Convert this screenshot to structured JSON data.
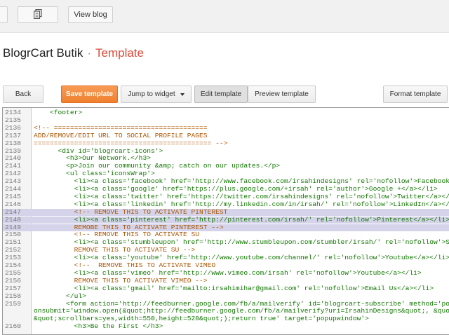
{
  "toolbar": {
    "view_blog": "View blog"
  },
  "header": {
    "blog_name": "BlogrCart Butik",
    "separator": "·",
    "page_title": "Template"
  },
  "actions": {
    "back": "Back",
    "save_template": "Save template",
    "jump_to_widget": "Jump to widget",
    "edit_template": "Edit template",
    "preview_template": "Preview template",
    "format_template": "Format template"
  },
  "colors": {
    "accent_orange": "#f0802f",
    "page_title": "#dd4b39",
    "highlight": "#d5d3ea"
  },
  "editor": {
    "lines": [
      {
        "n": "2134",
        "t": "    <footer>",
        "c": "tag",
        "h": false
      },
      {
        "n": "2135",
        "t": "",
        "c": "txt",
        "h": false
      },
      {
        "n": "2136",
        "t": "<!-- ======================================",
        "c": "cmt",
        "h": false
      },
      {
        "n": "2137",
        "t": "ADD/REMOVE/EDIT URL TO SOCIAL PROFILE PAGES",
        "c": "cmt",
        "h": false
      },
      {
        "n": "2138",
        "t": "============================================ -->",
        "c": "cmt",
        "h": false
      },
      {
        "n": "2139",
        "t": "      <div id='blogrcart-icons'>",
        "c": "tag",
        "h": false
      },
      {
        "n": "2140",
        "t": "        <h3>Our Network.</h3>",
        "c": "tag",
        "h": false
      },
      {
        "n": "2141",
        "t": "        <p>Join our community &amp; catch on our updates.</p>",
        "c": "tag",
        "h": false
      },
      {
        "n": "2142",
        "t": "        <ul class='iconsWrap'>",
        "c": "tag",
        "h": false
      },
      {
        "n": "2143",
        "t": "          <li><a class='facebook' href='http://www.facebook.com/irsahindesigns' rel='nofollow'>Facebook</a></li>",
        "c": "tag",
        "h": false
      },
      {
        "n": "2144",
        "t": "          <li><a class='google' href='https://plus.google.com/+irsah' rel='author'>Google +</a></li>",
        "c": "tag",
        "h": false
      },
      {
        "n": "2145",
        "t": "          <li><a class='twitter' href='https://twitter.com/irsahindesigns' rel='nofollow'>Twitter</a></li>",
        "c": "tag",
        "h": false
      },
      {
        "n": "2146",
        "t": "          <li><a class='linkedin' href='http://my.linkedin.com/in/irsah/' rel='nofollow'>LinkedIn</a></li>",
        "c": "tag",
        "h": false
      },
      {
        "n": "2147",
        "t": "          <!-- REMOVE THIS TO ACTIVATE PINTEREST",
        "c": "cmt",
        "h": true
      },
      {
        "n": "2148",
        "t": "          <li><a class='pinterest' href='http://pinterest.com/irsah/' rel='nofollow'>Pinterest</a></li>",
        "c": "tag",
        "h": true
      },
      {
        "n": "2149",
        "t": "          REMOBE THIS TO ACTIVATE PINTEREST -->",
        "c": "cmt",
        "h": true
      },
      {
        "n": "2150",
        "t": "          <!-- REMOVE THIS TO ACTIVATE SU",
        "c": "cmt",
        "h": false
      },
      {
        "n": "2151",
        "t": "          <li><a class='stumbleupon' href='http://www.stumbleupon.com/stumbler/irsah/' rel='nofollow'>StumbleUpon</a></li>",
        "c": "tag",
        "h": false
      },
      {
        "n": "2152",
        "t": "          REMOVE THIS TO ACTIVATE SU -->",
        "c": "cmt",
        "h": false
      },
      {
        "n": "2153",
        "t": "          <li><a class='youtube' href='http://www.youtube.com/channel/' rel='nofollow'>Youtube</a></li>",
        "c": "tag",
        "h": false
      },
      {
        "n": "2154",
        "t": "          <!--  REMOVE THIS TO ACTIVATE VIMEO",
        "c": "cmt",
        "h": false
      },
      {
        "n": "2155",
        "t": "          <li><a class='vimeo' href='http://www.vimeo.com/irsah' rel='nofollow'>Youtube</a></li>",
        "c": "tag",
        "h": false
      },
      {
        "n": "2156",
        "t": "          REMOVE THIS TO ACTIVATE VIMEO -->",
        "c": "cmt",
        "h": false
      },
      {
        "n": "2157",
        "t": "          <li><a class='gmail' href='mailto:irsahimihar@gmail.com' rel='nofollow'>Email Us</a></li>",
        "c": "tag",
        "h": false
      },
      {
        "n": "2158",
        "t": "        </ul>",
        "c": "tag",
        "h": false
      },
      {
        "n": "2159",
        "t": "        <form action='http://feedburner.google.com/fb/a/mailverify' id='blogrcart-subscribe' method='post'",
        "c": "tag",
        "h": false
      },
      {
        "n": "",
        "t": "onsubmit='window.open(&quot;http://feedburner.google.com/fb/a/mailverify?uri=IrsahinDesigns&quot;, &quot;popupwindow&quot;,",
        "c": "tag",
        "h": false
      },
      {
        "n": "",
        "t": "&quot;scrollbars=yes,width=550,height=520&quot;);return true' target='popupwindow'>",
        "c": "tag",
        "h": false
      },
      {
        "n": "2160",
        "t": "          <h3>Be the First </h3>",
        "c": "tag",
        "h": false
      }
    ]
  }
}
